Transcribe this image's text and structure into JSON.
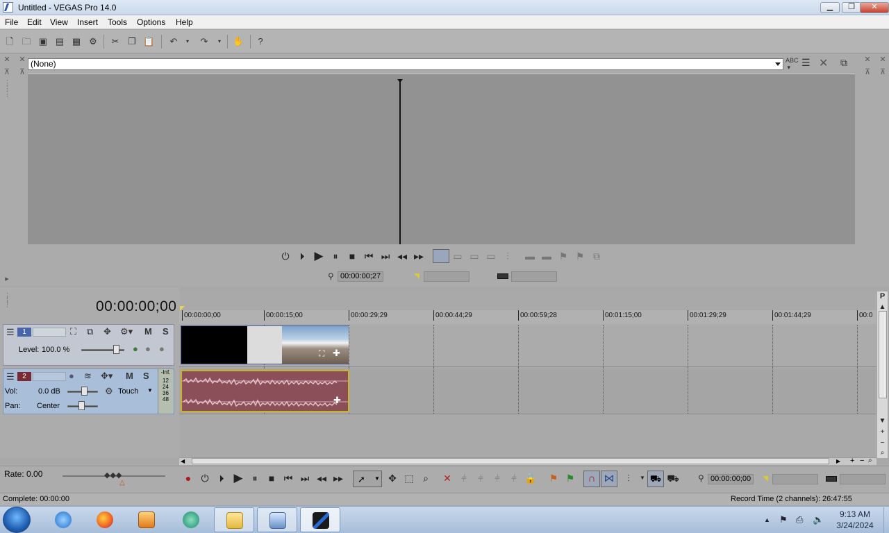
{
  "window": {
    "title": "Untitled - VEGAS Pro 14.0",
    "min": "▁",
    "max": "❐",
    "close": "✕"
  },
  "menu": [
    "File",
    "Edit",
    "View",
    "Insert",
    "Tools",
    "Options",
    "Help"
  ],
  "preview": {
    "fx_selected": "(None)",
    "cursor_time": "00:00:00;27"
  },
  "timeline": {
    "current_time": "00:00:00;00",
    "ruler_ticks": [
      "00:00:00;00",
      "00:00:15;00",
      "00:00:29;29",
      "00:00:44;29",
      "00:00:59;28",
      "00:01:15;00",
      "00:01:29;29",
      "00:01:44;29",
      "00:0"
    ],
    "video_track": {
      "number": "1",
      "m": "M",
      "s": "S",
      "level_label": "Level:",
      "level_value": "100.0 %"
    },
    "audio_track": {
      "number": "2",
      "m": "M",
      "s": "S",
      "vol_label": "Vol:",
      "vol_value": "0.0 dB",
      "pan_label": "Pan:",
      "pan_value": "Center",
      "automation": "Touch",
      "meter_labels": [
        "-Inf.",
        "12",
        "24",
        "36",
        "48"
      ]
    },
    "rate_label": "Rate: 0.00",
    "bottom_time": "00:00:00;00"
  },
  "status": {
    "left": "Complete: 00:00:00",
    "right": "Record Time (2 channels): 26:47:55"
  },
  "taskbar": {
    "time": "9:13 AM",
    "date": "3/24/2024"
  },
  "colors": {
    "accent_audio": "#8a4f58",
    "clip_border": "#c9b22e",
    "video_track": "#c2c7d2",
    "audio_track": "#a9bed8"
  }
}
